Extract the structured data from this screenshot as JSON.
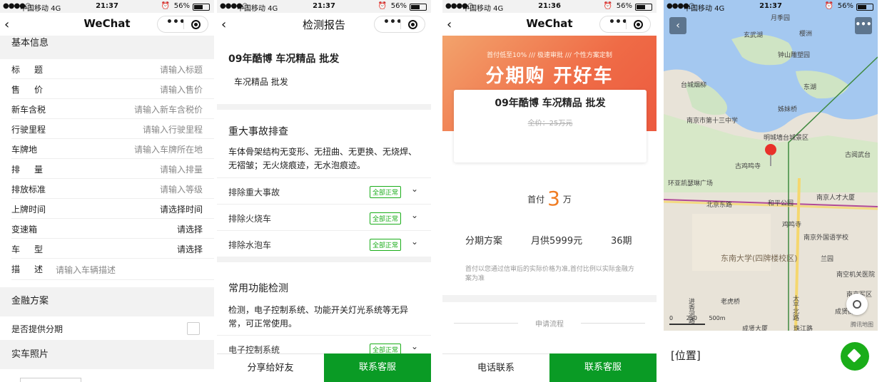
{
  "status": {
    "carrier": "中国移动 4G",
    "battery": "56%",
    "times": [
      "21:37",
      "21:37",
      "21:36",
      "21:37"
    ]
  },
  "panel1": {
    "nav_title": "WeChat",
    "section_basic": "基本信息",
    "fields": [
      {
        "label": "标题",
        "placeholder": "请输入标题",
        "dark": false
      },
      {
        "label": "售价",
        "placeholder": "请输入售价",
        "dark": false
      },
      {
        "label": "新车含税",
        "placeholder": "请输入新车含税价",
        "dark": false
      },
      {
        "label": "行驶里程",
        "placeholder": "请输入行驶里程",
        "dark": false
      },
      {
        "label": "车牌地",
        "placeholder": "请输入车牌所在地",
        "dark": false
      },
      {
        "label": "排量",
        "placeholder": "请输入排量",
        "dark": false
      },
      {
        "label": "排放标准",
        "placeholder": "请输入等级",
        "dark": false
      },
      {
        "label": "上牌时间",
        "placeholder": "请选择时间",
        "dark": true
      },
      {
        "label": "变速箱",
        "placeholder": "请选择",
        "dark": true
      },
      {
        "label": "车型",
        "placeholder": "请选择",
        "dark": true
      }
    ],
    "desc_label": "描述",
    "desc_placeholder": "请输入车辆描述",
    "section_finance": "金融方案",
    "installment_label": "是否提供分期",
    "section_photos": "实车照片"
  },
  "panel2": {
    "nav_title": "检测报告",
    "car_title": "09年酷博 车况精品 批发",
    "car_sub": "车况精品 批发",
    "accident_title": "重大事故排查",
    "accident_text": "车体骨架结构无变形、无扭曲、无更换、无烧焊、无褶皱；无火烧痕迹，无水泡痕迹。",
    "checks": [
      {
        "label": "排除重大事故",
        "badge": "全部正常"
      },
      {
        "label": "排除火烧车",
        "badge": "全部正常"
      },
      {
        "label": "排除水泡车",
        "badge": "全部正常"
      }
    ],
    "func_title": "常用功能检测",
    "func_text": "检测，电子控制系统、功能开关灯光系统等无异常，可正常使用。",
    "func_check": {
      "label": "电子控制系统",
      "badge": "全部正常"
    },
    "share_button": "分享给好友",
    "service_button": "联系客服"
  },
  "panel3": {
    "nav_title": "WeChat",
    "banner_sub": "首付低至10%  ///  极速审批  ///  个性方案定制",
    "banner_big": "分期购 开好车",
    "car_title": "09年酷博 车况精品 批发",
    "price_full": "全价：25万元",
    "down_prefix": "首付",
    "down_value": "3",
    "down_unit": "万",
    "plan_label": "分期方案",
    "plan_monthly": "月供5999元",
    "plan_term": "36期",
    "note": "首付以您通过信审后的实际价格为准,首付比例以实际金融方案为准",
    "flow_label": "申请流程",
    "phone_button": "电话联系",
    "service_button": "联系客服"
  },
  "panel4": {
    "location_label": "[位置]",
    "map_labels": [
      "月季园",
      "玄武湖",
      "樱洲",
      "钟山雕塑园",
      "台城烟柳",
      "东湖",
      "南京市第十三中学",
      "姊妹桥",
      "明城墙台城景区",
      "古鸡鸣寺",
      "古阅武台",
      "环亚凯瑟琳广场",
      "和平公园",
      "南京人才大厦",
      "北京东路",
      "鸡鸣寺",
      "南京外国语学校",
      "东南大学(四牌楼校区)",
      "南空机关医院",
      "老虎桥",
      "太平北路",
      "成贤街",
      "兰园",
      "进香河路",
      "成贤大厦",
      "南京军区",
      "珠江路"
    ],
    "scale_values": [
      "0",
      "250",
      "500m"
    ],
    "map_copyright": "腾讯地图"
  }
}
